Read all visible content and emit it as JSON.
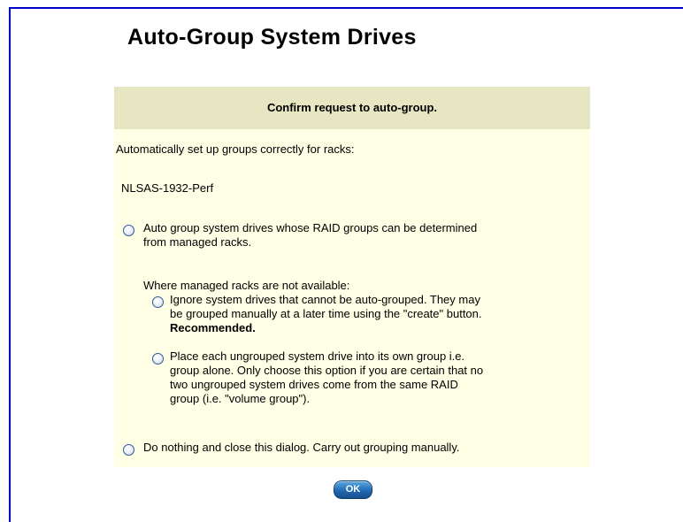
{
  "title": "Auto-Group System Drives",
  "panel": {
    "header": "Confirm request to auto-group.",
    "intro": "Automatically set up groups correctly for racks:",
    "rack_name": "NLSAS-1932-Perf",
    "option_auto": {
      "line1": "Auto group system drives whose RAID groups can be determined",
      "line2": "from managed racks."
    },
    "fallback_heading": "Where managed racks are not available:",
    "option_ignore": {
      "line1": "Ignore system drives that cannot be auto-grouped. They may",
      "line2": "be grouped manually at a later time using the \"create\" button.",
      "emphasis": "Recommended."
    },
    "option_place": {
      "line1": "Place each ungrouped system drive into its own group i.e.",
      "line2": "group alone. Only choose this option if you are certain that no",
      "line3": "two ungrouped system drives come from the same RAID",
      "line4": "group (i.e. \"volume group\")."
    },
    "option_nothing": {
      "line1": "Do nothing and close this dialog. Carry out grouping manually."
    }
  },
  "ok_label": "OK",
  "colors": {
    "frame_border": "#0000cc",
    "panel_background": "#ffffe6",
    "header_background": "#e6e6c2",
    "button": "#1f66b0"
  }
}
